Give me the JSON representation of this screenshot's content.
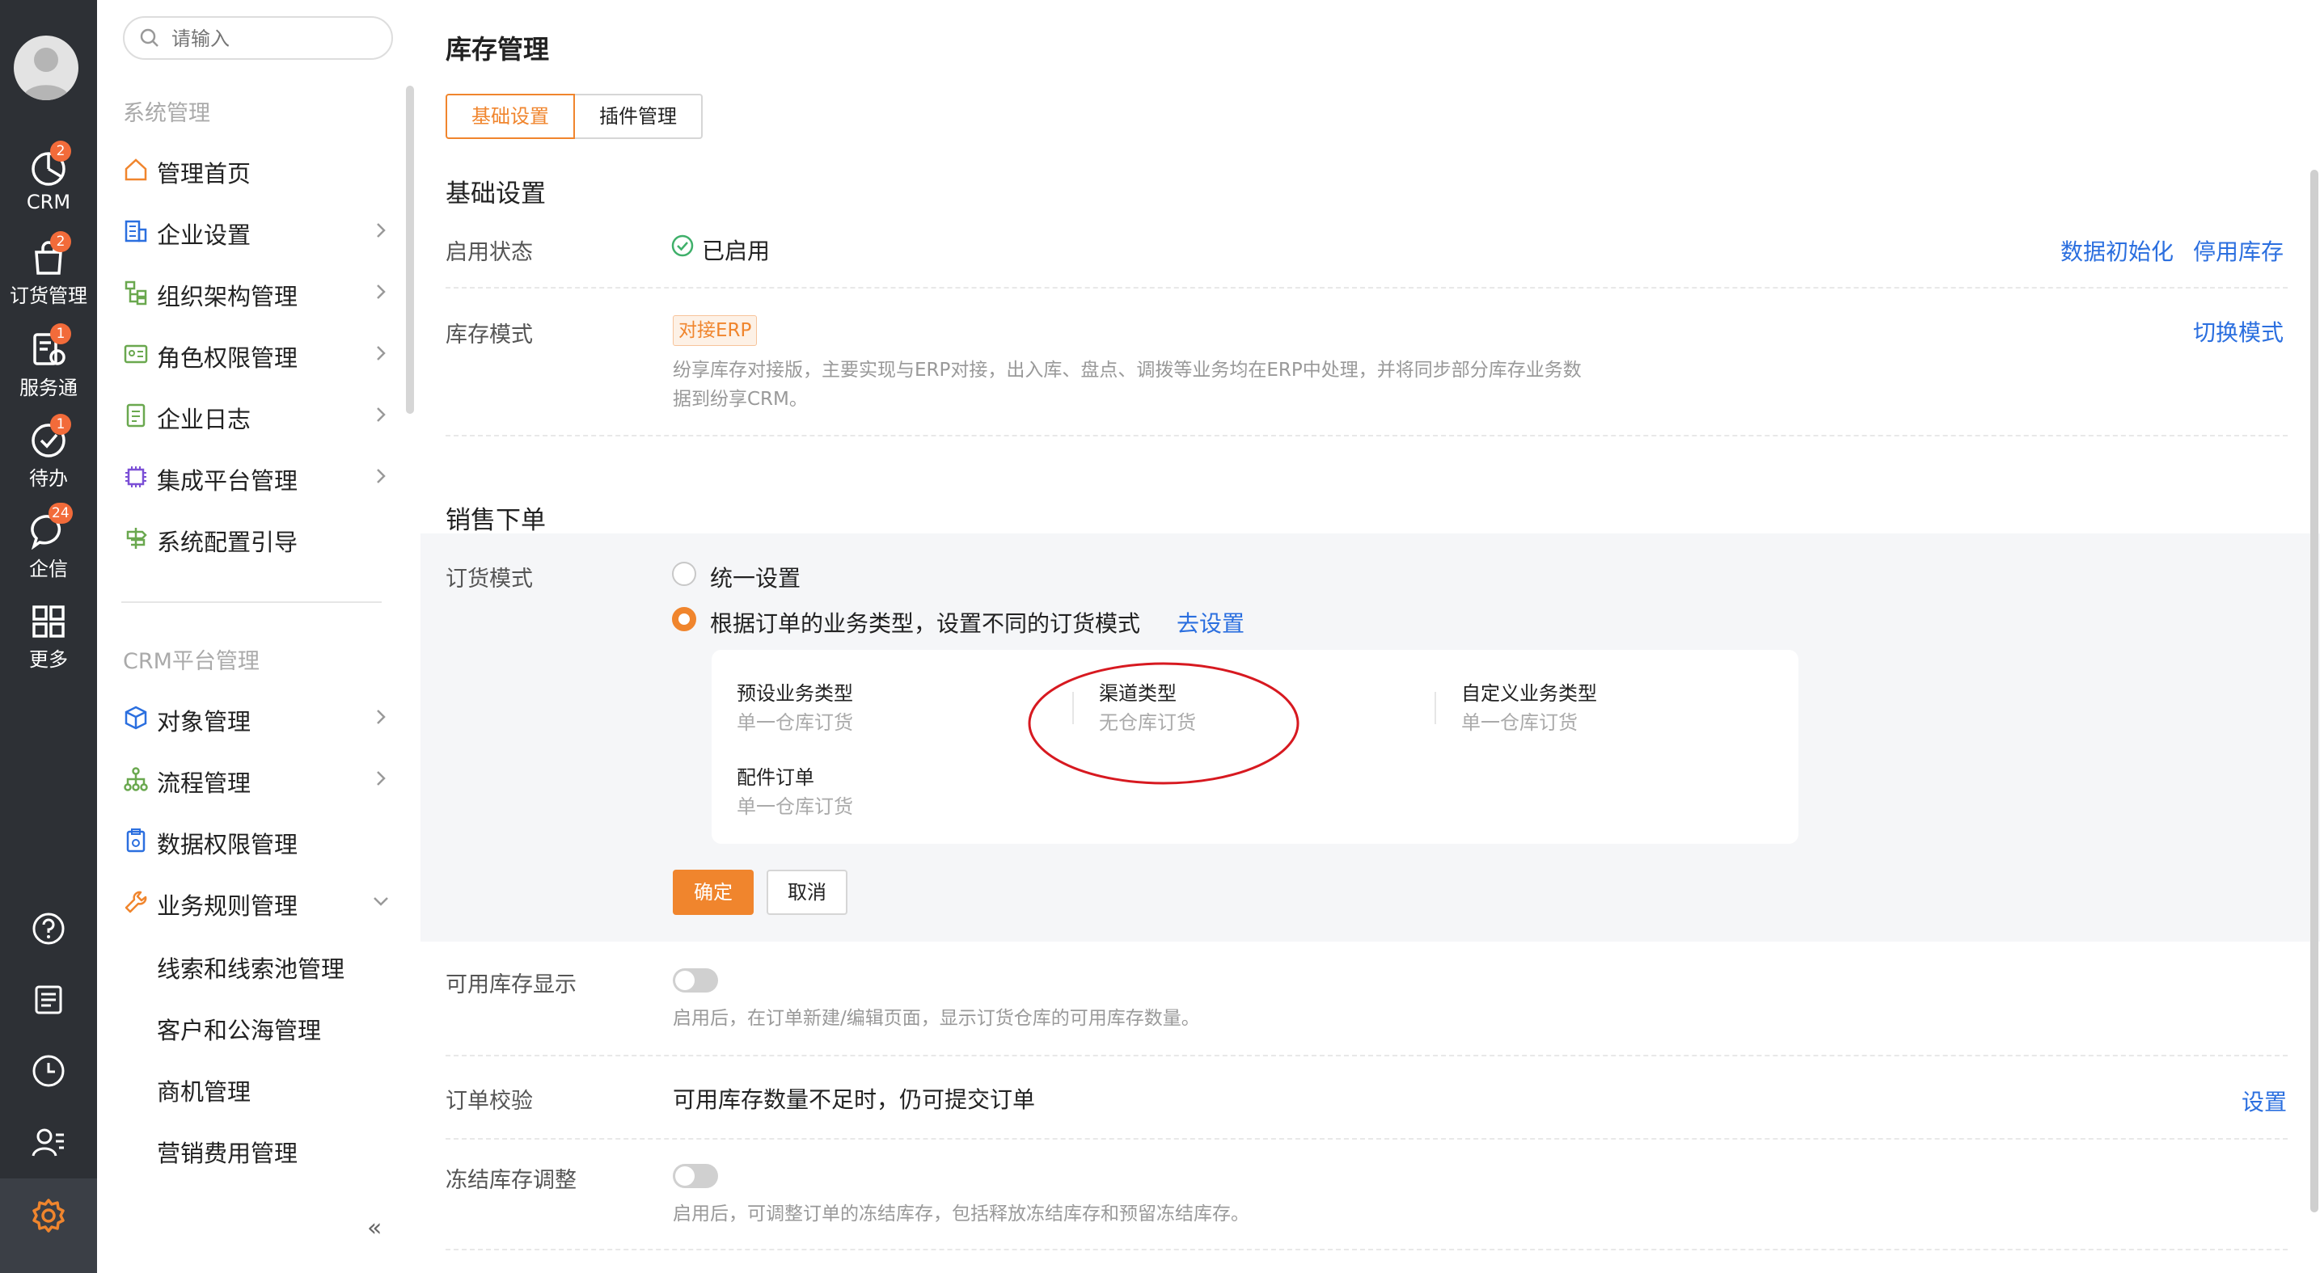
{
  "rail": {
    "items": [
      {
        "label": "CRM",
        "badge": "2"
      },
      {
        "label": "订货管理",
        "badge": "2"
      },
      {
        "label": "服务通",
        "badge": "1"
      },
      {
        "label": "待办",
        "badge": "1"
      },
      {
        "label": "企信",
        "badge": "24"
      },
      {
        "label": "更多",
        "badge": ""
      }
    ]
  },
  "sidebar": {
    "search_placeholder": "请输入",
    "group1": "系统管理",
    "items1": [
      {
        "label": "管理首页"
      },
      {
        "label": "企业设置"
      },
      {
        "label": "组织架构管理"
      },
      {
        "label": "角色权限管理"
      },
      {
        "label": "企业日志"
      },
      {
        "label": "集成平台管理"
      },
      {
        "label": "系统配置引导"
      }
    ],
    "group2": "CRM平台管理",
    "items2": [
      {
        "label": "对象管理"
      },
      {
        "label": "流程管理"
      },
      {
        "label": "数据权限管理"
      },
      {
        "label": "业务规则管理"
      }
    ],
    "sub_items": [
      {
        "label": "线索和线索池管理"
      },
      {
        "label": "客户和公海管理"
      },
      {
        "label": "商机管理"
      },
      {
        "label": "营销费用管理"
      }
    ],
    "collapse": "«"
  },
  "page": {
    "title": "库存管理",
    "tabs": [
      {
        "label": "基础设置"
      },
      {
        "label": "插件管理"
      }
    ],
    "section_basic": "基础设置",
    "status_label": "启用状态",
    "status_value": "已启用",
    "link_init": "数据初始化",
    "link_disable": "停用库存",
    "mode_label": "库存模式",
    "mode_tag": "对接ERP",
    "mode_desc1": "纷享库存对接版，主要实现与ERP对接，出入库、盘点、调拨等业务均在ERP中处理，并将同步部分库存业务数",
    "mode_desc2": "据到纷享CRM。",
    "link_switch": "切换模式",
    "section_sales": "销售下单",
    "order_mode_label": "订货模式",
    "option1": "统一设置",
    "option2": "根据订单的业务类型，设置不同的订货模式",
    "link_goset": "去设置",
    "biz_types": [
      {
        "name": "预设业务类型",
        "mode": "单一仓库订货"
      },
      {
        "name": "渠道类型",
        "mode": "无仓库订货"
      },
      {
        "name": "自定义业务类型",
        "mode": "单一仓库订货"
      },
      {
        "name": "配件订单",
        "mode": "单一仓库订货"
      }
    ],
    "btn_ok": "确定",
    "btn_cancel": "取消",
    "avail_label": "可用库存显示",
    "avail_desc": "启用后，在订单新建/编辑页面，显示订货仓库的可用库存数量。",
    "check_label": "订单校验",
    "check_value": "可用库存数量不足时，仍可提交订单",
    "link_setting": "设置",
    "freeze_label": "冻结库存调整",
    "freeze_desc": "启用后，可调整订单的冻结库存，包括释放冻结库存和预留冻结库存。"
  },
  "colors": {
    "accent": "#f0852d",
    "link": "#2b6fdf",
    "rail": "#2d3035",
    "annotation": "#d71920"
  }
}
